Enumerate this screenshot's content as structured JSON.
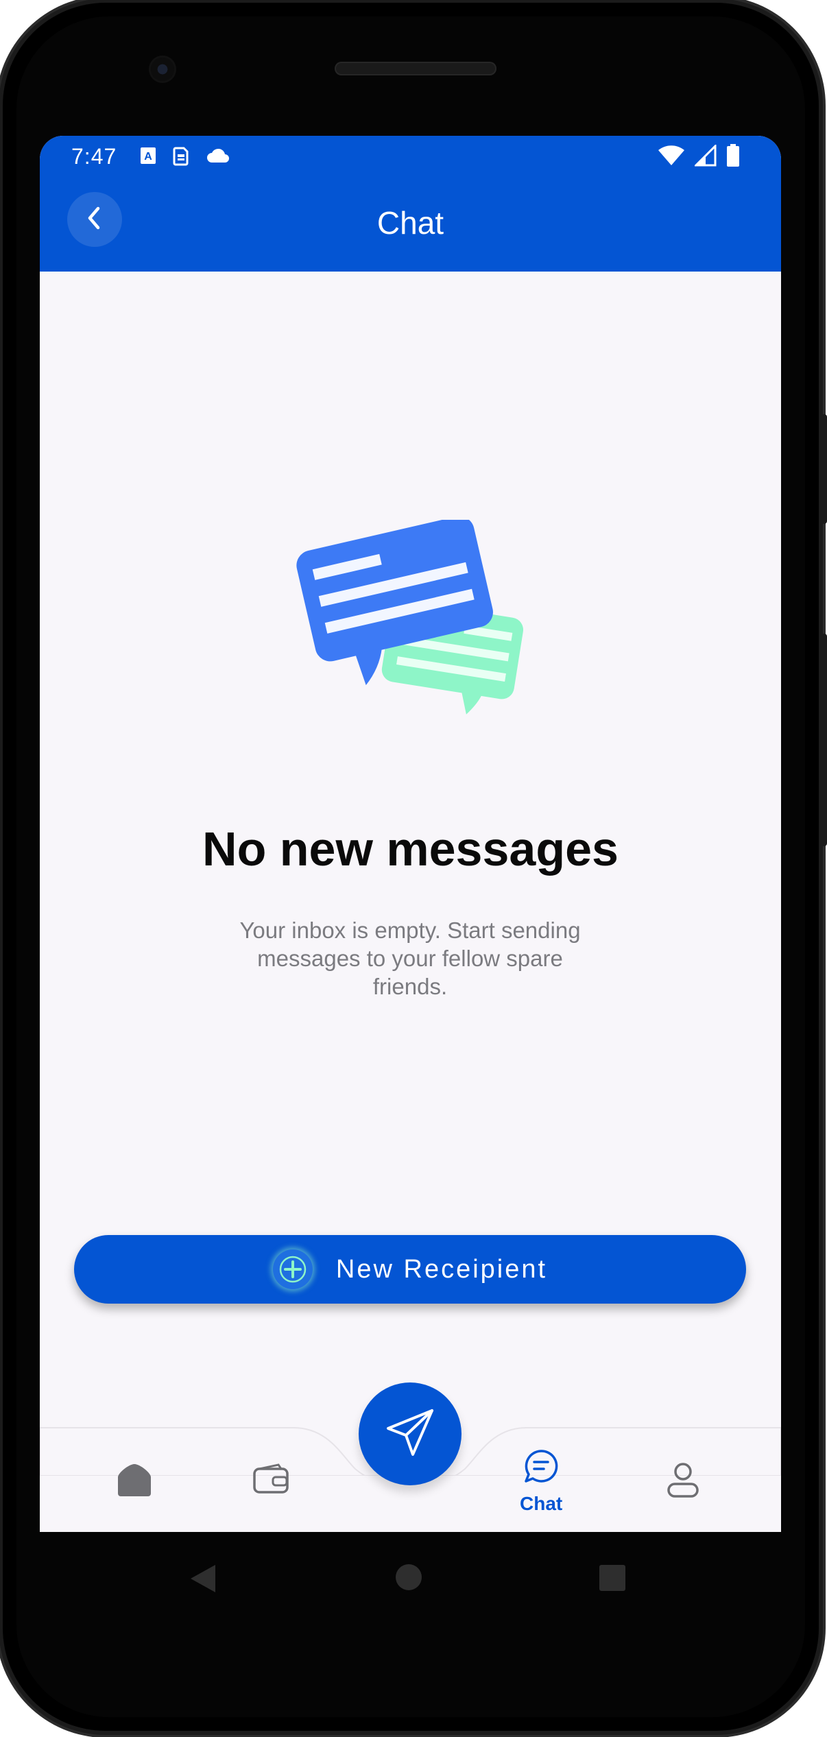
{
  "status_bar": {
    "time": "7:47",
    "left_icons": [
      "text-a-icon",
      "sim-icon",
      "cloud-icon"
    ],
    "right_icons": [
      "wifi-icon",
      "signal-icon",
      "battery-icon"
    ]
  },
  "app_bar": {
    "title": "Chat",
    "back_icon": "chevron-left-icon"
  },
  "empty_state": {
    "illustration": "chat-bubbles-illustration",
    "title": "No new messages",
    "description": "Your inbox is empty. Start sending messages to your fellow spare friends."
  },
  "primary_action": {
    "label": "New Receipient",
    "icon": "plus-circle-icon"
  },
  "bottom_nav": {
    "items": [
      {
        "name": "home",
        "icon": "home-icon",
        "label": "",
        "active": false
      },
      {
        "name": "wallet",
        "icon": "wallet-icon",
        "label": "",
        "active": false
      },
      {
        "name": "chat",
        "icon": "chat-icon",
        "label": "Chat",
        "active": true
      },
      {
        "name": "profile",
        "icon": "user-icon",
        "label": "",
        "active": false
      }
    ],
    "fab_icon": "send-icon"
  },
  "colors": {
    "primary": "#0455d3",
    "background": "#f8f6fa",
    "bubble_blue": "#3d7af5",
    "bubble_green": "#8ef5c8",
    "inactive_icon": "#6e6e72"
  }
}
